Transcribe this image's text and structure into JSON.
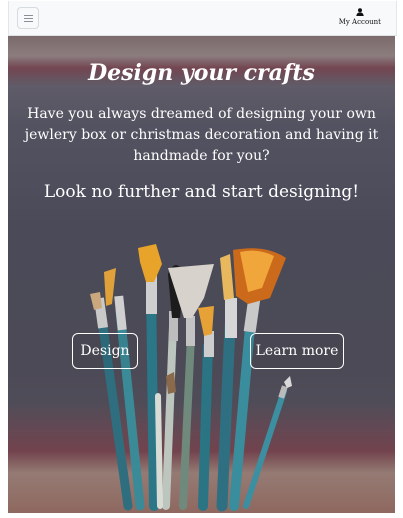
{
  "navbar": {
    "toggler_icon": "hamburger-menu-icon",
    "account_icon": "user-icon",
    "account_label": "My Account"
  },
  "hero": {
    "title": "Design your crafts",
    "lead": "Have you always dreamed of designing your own jewlery box or christmas decoration and having it handmade for you?",
    "subtitle": "Look no further and start designing!",
    "buttons": {
      "design_label": "Design",
      "learn_more_label": "Learn more"
    },
    "background_image": "paint-brushes-in-jar",
    "colors": {
      "text": "#ffffff",
      "button_border": "#ffffff",
      "navbar_bg": "#f8f9fa"
    }
  }
}
